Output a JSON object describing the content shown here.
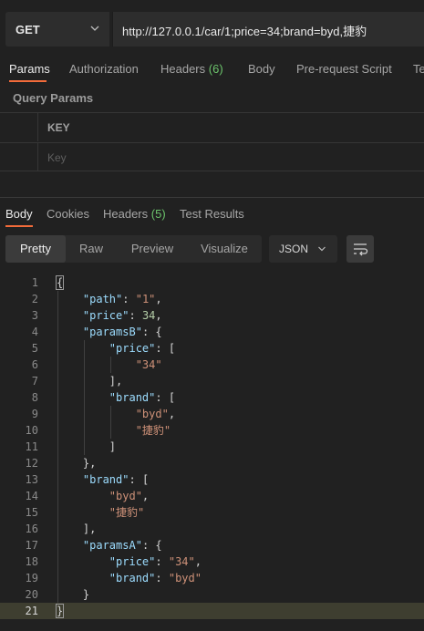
{
  "request": {
    "method": "GET",
    "url": "http://127.0.0.1/car/1;price=34;brand=byd,捷豹"
  },
  "request_tabs": [
    {
      "label": "Params",
      "count": ""
    },
    {
      "label": "Authorization",
      "count": ""
    },
    {
      "label": "Headers",
      "count": "(6)"
    },
    {
      "label": "Body",
      "count": ""
    },
    {
      "label": "Pre-request Script",
      "count": ""
    },
    {
      "label": "Te",
      "count": ""
    }
  ],
  "query_params": {
    "title": "Query Params",
    "key_header": "KEY",
    "key_placeholder": "Key"
  },
  "response_tabs": [
    {
      "label": "Body",
      "count": ""
    },
    {
      "label": "Cookies",
      "count": ""
    },
    {
      "label": "Headers",
      "count": "(5)"
    },
    {
      "label": "Test Results",
      "count": ""
    }
  ],
  "view_modes": [
    "Pretty",
    "Raw",
    "Preview",
    "Visualize"
  ],
  "format": "JSON",
  "icons": {
    "method_dropdown": "chevron-down-icon",
    "format_dropdown": "chevron-down-icon",
    "wrap": "wrap-lines-icon"
  },
  "colors": {
    "accent": "#f26b3a",
    "count_green": "#6cc46c",
    "json_key": "#9cdcfe",
    "json_string": "#ce9178",
    "json_number": "#b5cea8"
  },
  "response_body": {
    "path": "1",
    "price": 34,
    "paramsB": {
      "price": [
        "34"
      ],
      "brand": [
        "byd",
        "捷豹"
      ]
    },
    "brand": [
      "byd",
      "捷豹"
    ],
    "paramsA": {
      "price": "34",
      "brand": "byd"
    }
  },
  "code_lines": [
    {
      "n": "1",
      "t": "{"
    },
    {
      "n": "2",
      "t": "    \"path\": \"1\","
    },
    {
      "n": "3",
      "t": "    \"price\": 34,"
    },
    {
      "n": "4",
      "t": "    \"paramsB\": {"
    },
    {
      "n": "5",
      "t": "        \"price\": ["
    },
    {
      "n": "6",
      "t": "            \"34\""
    },
    {
      "n": "7",
      "t": "        ],"
    },
    {
      "n": "8",
      "t": "        \"brand\": ["
    },
    {
      "n": "9",
      "t": "            \"byd\","
    },
    {
      "n": "10",
      "t": "            \"捷豹\""
    },
    {
      "n": "11",
      "t": "        ]"
    },
    {
      "n": "12",
      "t": "    },"
    },
    {
      "n": "13",
      "t": "    \"brand\": ["
    },
    {
      "n": "14",
      "t": "        \"byd\","
    },
    {
      "n": "15",
      "t": "        \"捷豹\""
    },
    {
      "n": "16",
      "t": "    ],"
    },
    {
      "n": "17",
      "t": "    \"paramsA\": {"
    },
    {
      "n": "18",
      "t": "        \"price\": \"34\","
    },
    {
      "n": "19",
      "t": "        \"brand\": \"byd\""
    },
    {
      "n": "20",
      "t": "    }"
    },
    {
      "n": "21",
      "t": "}"
    }
  ]
}
